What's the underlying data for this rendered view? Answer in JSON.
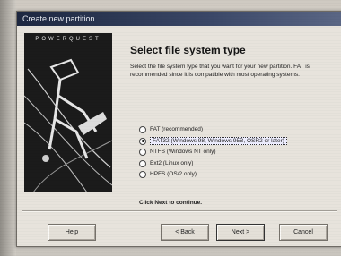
{
  "window": {
    "title": "Create new partition"
  },
  "sidebar": {
    "brand": "POWERQUEST"
  },
  "page": {
    "heading": "Select file system type",
    "description": "Select the file system type that you want for your new partition. FAT is recommended since it is compatible with most operating systems."
  },
  "options": [
    {
      "label": "FAT (recommended)",
      "selected": false
    },
    {
      "label": "FAT32 (Windows 98, Windows 95B, OSR2 or later)",
      "selected": true
    },
    {
      "label": "NTFS (Windows NT only)",
      "selected": false
    },
    {
      "label": "Ext2 (Linux only)",
      "selected": false
    },
    {
      "label": "HPFS (OS/2 only)",
      "selected": false
    }
  ],
  "hint": "Click Next to continue.",
  "buttons": {
    "help": "Help",
    "back": "< Back",
    "next": "Next >",
    "cancel": "Cancel"
  }
}
